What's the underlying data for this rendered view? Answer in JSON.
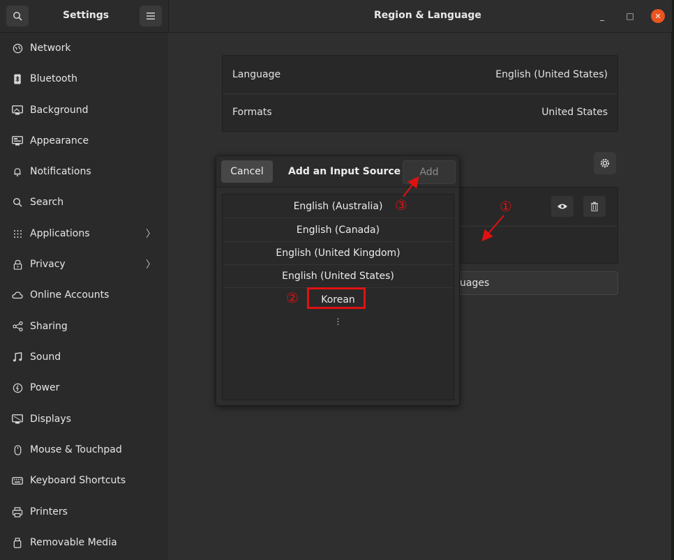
{
  "header": {
    "sidebar_title": "Settings",
    "page_title": "Region & Language",
    "search_icon": "search-icon",
    "menu_icon": "hamburger-menu-icon",
    "minimize": "_",
    "maximize": "□",
    "close": "✕"
  },
  "sidebar": {
    "items": [
      {
        "label": "Network",
        "icon": "network-icon"
      },
      {
        "label": "Bluetooth",
        "icon": "bluetooth-icon"
      },
      {
        "label": "Background",
        "icon": "background-icon"
      },
      {
        "label": "Appearance",
        "icon": "appearance-icon"
      },
      {
        "label": "Notifications",
        "icon": "bell-icon"
      },
      {
        "label": "Search",
        "icon": "search-icon"
      },
      {
        "label": "Applications",
        "icon": "apps-grid-icon",
        "chevron": true
      },
      {
        "label": "Privacy",
        "icon": "lock-icon",
        "chevron": true
      },
      {
        "label": "Online Accounts",
        "icon": "cloud-icon"
      },
      {
        "label": "Sharing",
        "icon": "share-icon"
      },
      {
        "label": "Sound",
        "icon": "music-note-icon"
      },
      {
        "label": "Power",
        "icon": "power-icon"
      },
      {
        "label": "Displays",
        "icon": "display-icon"
      },
      {
        "label": "Mouse & Touchpad",
        "icon": "mouse-icon"
      },
      {
        "label": "Keyboard Shortcuts",
        "icon": "keyboard-icon"
      },
      {
        "label": "Printers",
        "icon": "printer-icon"
      },
      {
        "label": "Removable Media",
        "icon": "removable-media-icon"
      }
    ]
  },
  "region": {
    "language_label": "Language",
    "language_value": "English (United States)",
    "formats_label": "Formats",
    "formats_value": "United States",
    "manage_languages_partial": "uages"
  },
  "dialog": {
    "cancel": "Cancel",
    "title": "Add an Input Source",
    "add": "Add",
    "items": [
      "English (Australia)",
      "English (Canada)",
      "English (United Kingdom)",
      "English (United States)",
      "Korean"
    ],
    "more": "⋮"
  },
  "annotations": {
    "one": "①",
    "two": "②",
    "three": "③",
    "color": "#e11111"
  }
}
